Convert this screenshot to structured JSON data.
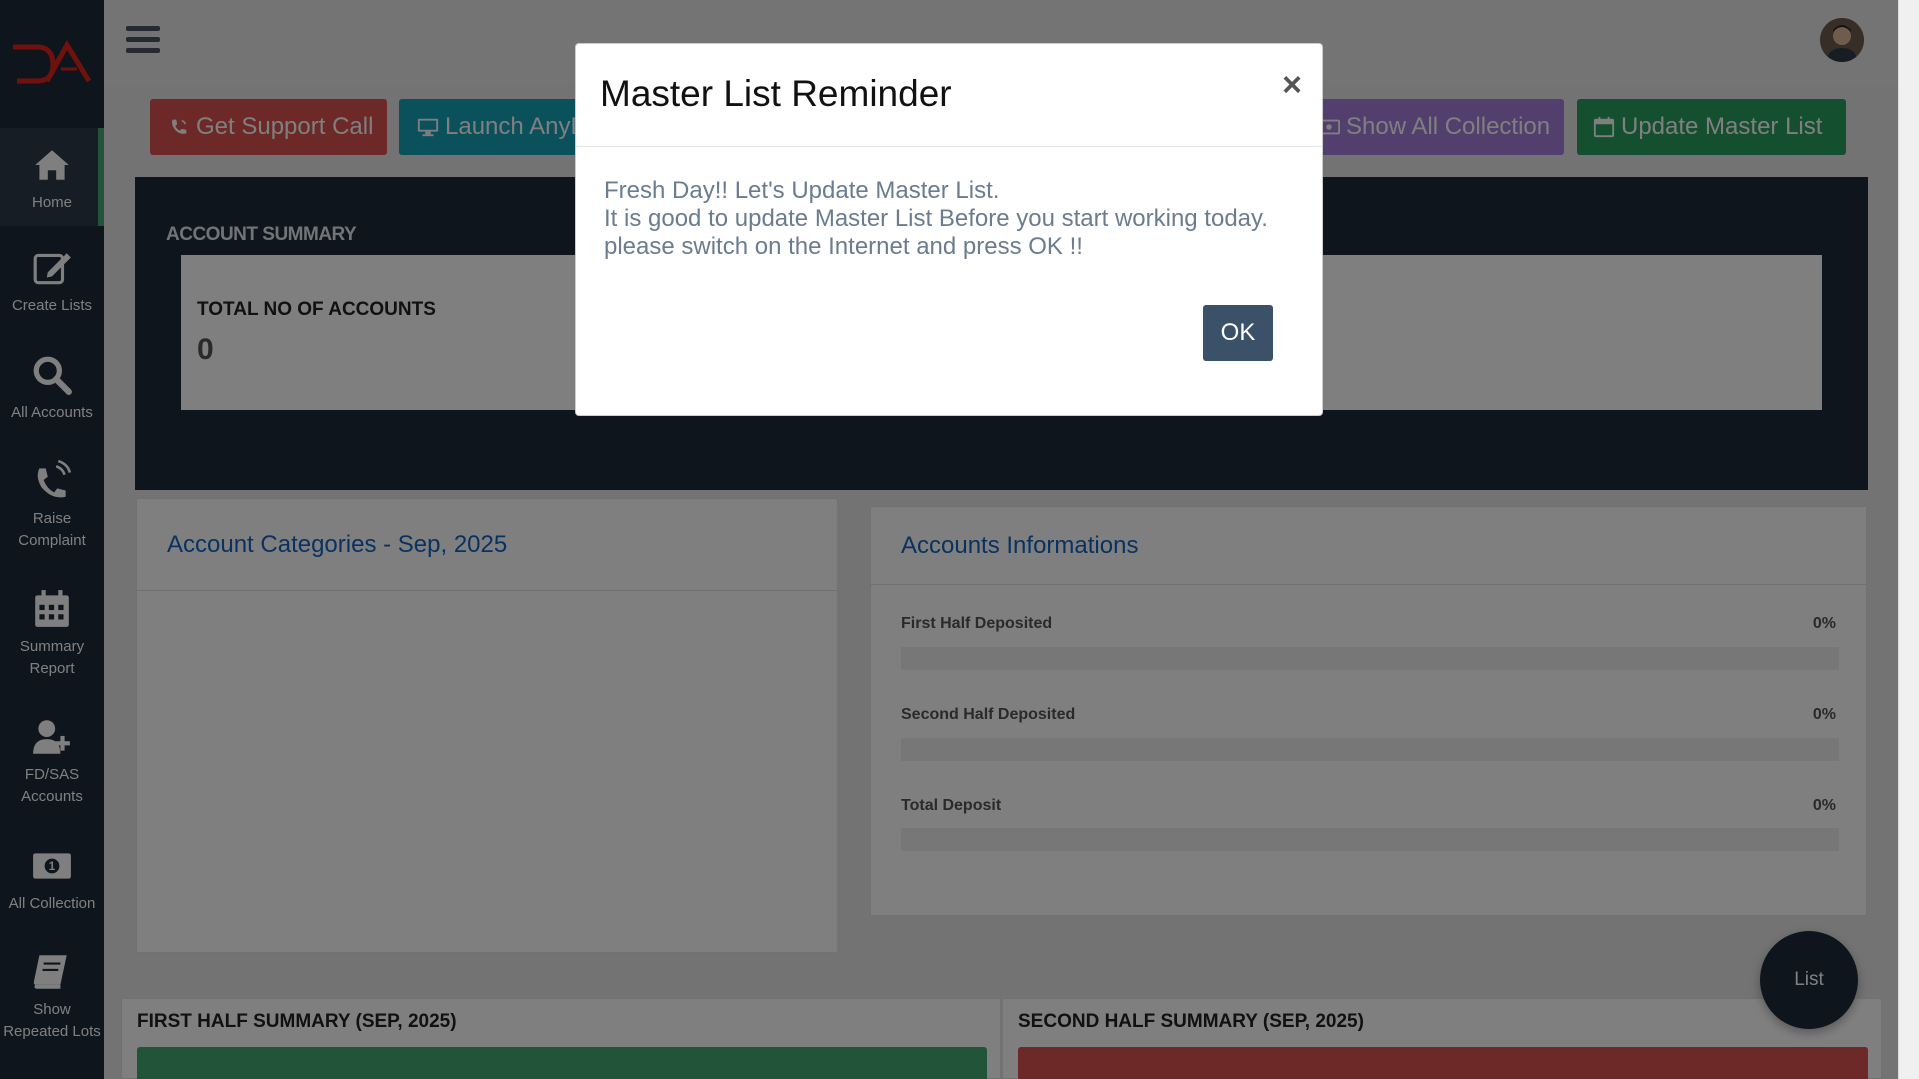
{
  "sidebar": {
    "items": [
      {
        "label": "Home",
        "icon": "home-icon"
      },
      {
        "label": "Create Lists",
        "icon": "edit-icon"
      },
      {
        "label": "All Accounts",
        "icon": "search-icon"
      },
      {
        "label": "Raise Complaint",
        "icon": "phone-icon"
      },
      {
        "label": "Summary Report",
        "icon": "calendar-icon"
      },
      {
        "label": "FD/SAS Accounts",
        "icon": "user-plus-icon"
      },
      {
        "label": "All Collection",
        "icon": "money-icon"
      },
      {
        "label": "Show Repeated Lots",
        "icon": "book-icon"
      }
    ]
  },
  "toolbar": {
    "support_label": "Get Support Call",
    "launch_label": "Launch AnyDesk",
    "show_all_label": "Show All Collection",
    "update_label": "Update Master List"
  },
  "account_summary": {
    "title": "ACCOUNT SUMMARY",
    "total_label": "TOTAL NO OF ACCOUNTS",
    "total_value": "0"
  },
  "categories": {
    "title": "Account Categories - Sep, 2025"
  },
  "accounts_info": {
    "title": "Accounts Informations",
    "rows": [
      {
        "label": "First Half Deposited",
        "value": "0%",
        "fraction": 0
      },
      {
        "label": "Second Half Deposited",
        "value": "0%",
        "fraction": 0
      },
      {
        "label": "Total Deposit",
        "value": "0%",
        "fraction": 0
      }
    ]
  },
  "first_half": {
    "title": "FIRST HALF SUMMARY (SEP, 2025)"
  },
  "second_half": {
    "title": "SECOND HALF SUMMARY (SEP, 2025)"
  },
  "float_button": {
    "label": "List"
  },
  "modal": {
    "title": "Master List Reminder",
    "close": "×",
    "line1": "Fresh Day!! Let's Update Master List.",
    "line2": "It is good to update Master List Before you start working today.",
    "line3": "please switch on the Internet and press OK !!",
    "ok_label": "OK"
  },
  "colors": {
    "sidebar": "#1f2a38",
    "support": "#d9534f",
    "launch": "#17a2b8",
    "show_all": "#a57fdc",
    "update": "#28a060",
    "green": "#43a873",
    "red": "#d9534f",
    "link": "#1565c0"
  }
}
